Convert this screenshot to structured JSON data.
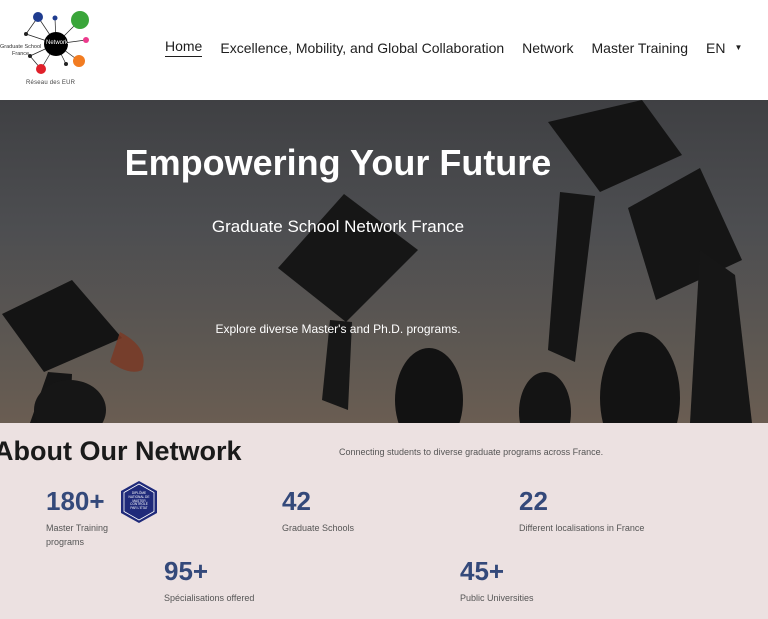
{
  "logo": {
    "center_text": "Network",
    "left_text": "Graduate School",
    "left_sub": "France",
    "tagline": "Réseau des EUR"
  },
  "nav": {
    "items": [
      "Home",
      "Excellence, Mobility, and Global Collaboration",
      "Network",
      "Master Training"
    ],
    "lang": "EN",
    "active": "Home"
  },
  "hero": {
    "title": "Empowering Your Future",
    "subtitle": "Graduate School Network France",
    "description": "Explore diverse Master's and Ph.D. programs."
  },
  "about": {
    "title": "About Our Network",
    "tagline": "Connecting students to diverse graduate programs across France.",
    "badge": {
      "line1": "DIPLÔME",
      "line2": "NATIONAL DE",
      "line3": "MASTER",
      "line4": "CONTRÔLÉ",
      "line5": "PAR L'ÉTAT"
    },
    "stats": [
      {
        "value": "180+",
        "label1": "Master Training",
        "label2": "programs"
      },
      {
        "value": "42",
        "label1": "Graduate Schools",
        "label2": ""
      },
      {
        "value": "22",
        "label1": "Different localisations in France",
        "label2": ""
      },
      {
        "value": "95+",
        "label1": "Spécialisations offered",
        "label2": ""
      },
      {
        "value": "45+",
        "label1": "Public Universities",
        "label2": ""
      }
    ]
  },
  "colors": {
    "accent": "#34497a",
    "about_bg": "#ece1e1",
    "logo_green": "#3aa53a",
    "logo_orange": "#f27c21",
    "logo_blue": "#1f3c8f",
    "logo_red": "#e0202a",
    "logo_pink": "#ec3a8c"
  }
}
